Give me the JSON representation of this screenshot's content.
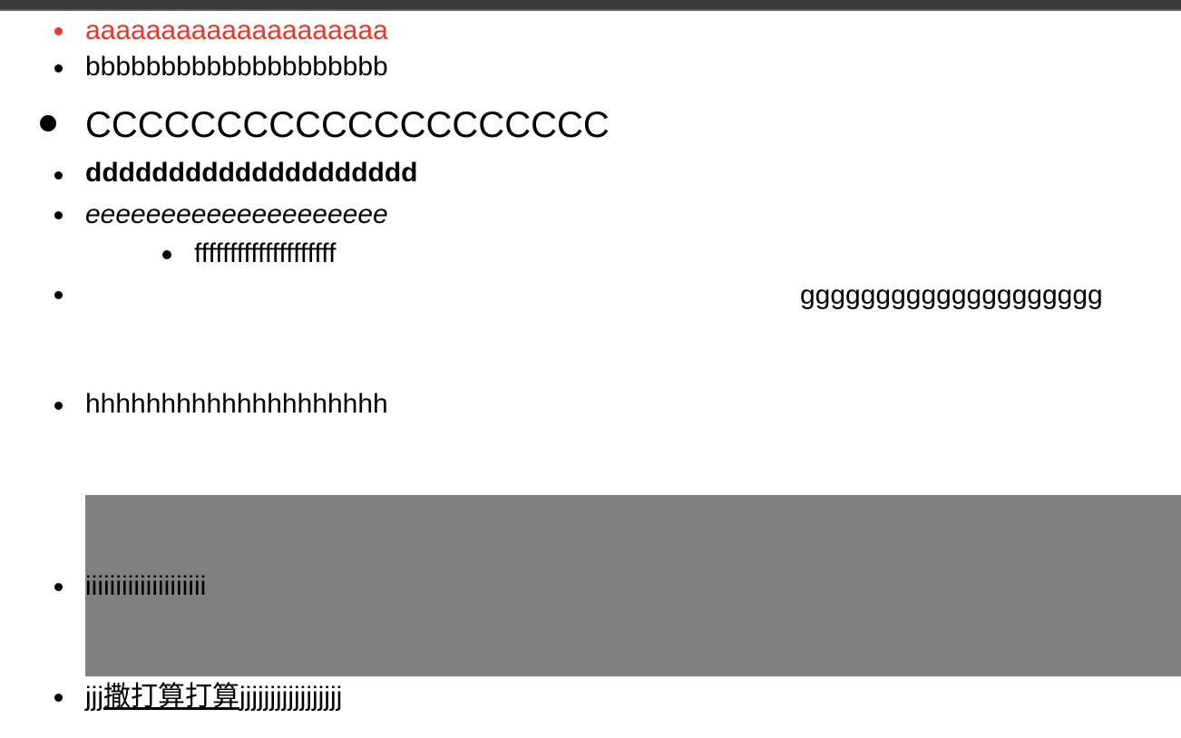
{
  "list": {
    "item_a": "aaaaaaaaaaaaaaaaaaaa",
    "item_b": "bbbbbbbbbbbbbbbbbbbb",
    "item_c": "CCCCCCCCCCCCCCCCCCCC",
    "item_d": "dddddddddddddddddddd",
    "item_e": "eeeeeeeeeeeeeeeeeeee",
    "item_f": "ffffffffffffffffffff",
    "item_g": "gggggggggggggggggggg",
    "item_h": "hhhhhhhhhhhhhhhhhhhh",
    "item_i": "iiiiiiiiiiiiiiiiiiii",
    "item_j_prefix": "jjj",
    "item_j_underlined": "撒打算打算",
    "item_j_suffix": "jjjjjjjjjjjjjjjjj"
  },
  "colors": {
    "item_a_color": "#e8382a",
    "highlight_box_color": "#808080"
  }
}
